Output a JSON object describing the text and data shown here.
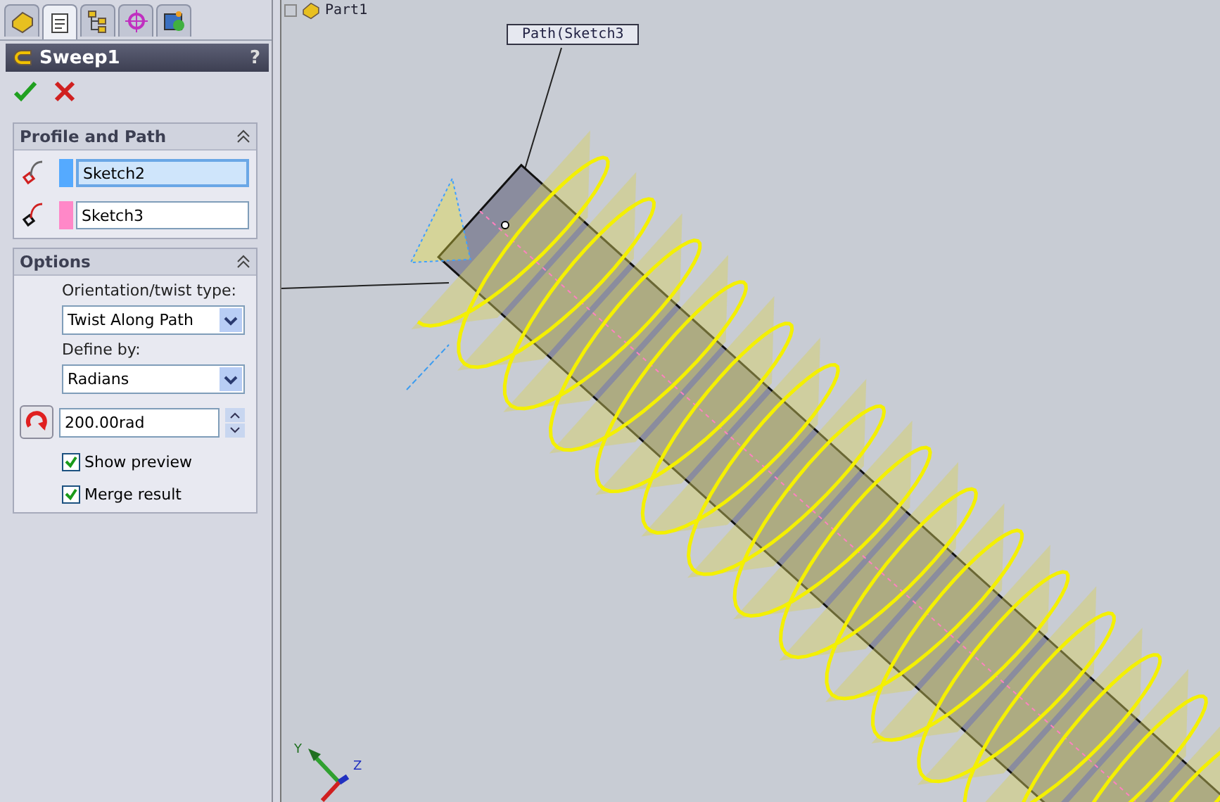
{
  "panel_tabs": [
    {
      "selected": false
    },
    {
      "selected": true
    },
    {
      "selected": false
    },
    {
      "selected": false
    },
    {
      "selected": false
    }
  ],
  "feature": {
    "title": "Sweep1",
    "help": "?"
  },
  "profile_and_path": {
    "title": "Profile and Path",
    "expanded": true,
    "items": [
      {
        "value": "Sketch2",
        "color": "#55aaff",
        "selected": true
      },
      {
        "value": "Sketch3",
        "color": "#ff88c8",
        "selected": false
      }
    ]
  },
  "options": {
    "title": "Options",
    "expanded": true,
    "orientation_label": "Orientation/twist type:",
    "orientation_value": "Twist Along Path",
    "define_label": "Define by:",
    "define_value": "Radians",
    "twist_value": "200.00rad",
    "checkboxes": [
      {
        "label": "Show preview",
        "checked": true
      },
      {
        "label": "Merge result",
        "checked": true
      }
    ]
  },
  "viewport": {
    "tree_item": "Part1",
    "callout": "Path(Sketch3",
    "axes": [
      "Y",
      "Z"
    ]
  }
}
